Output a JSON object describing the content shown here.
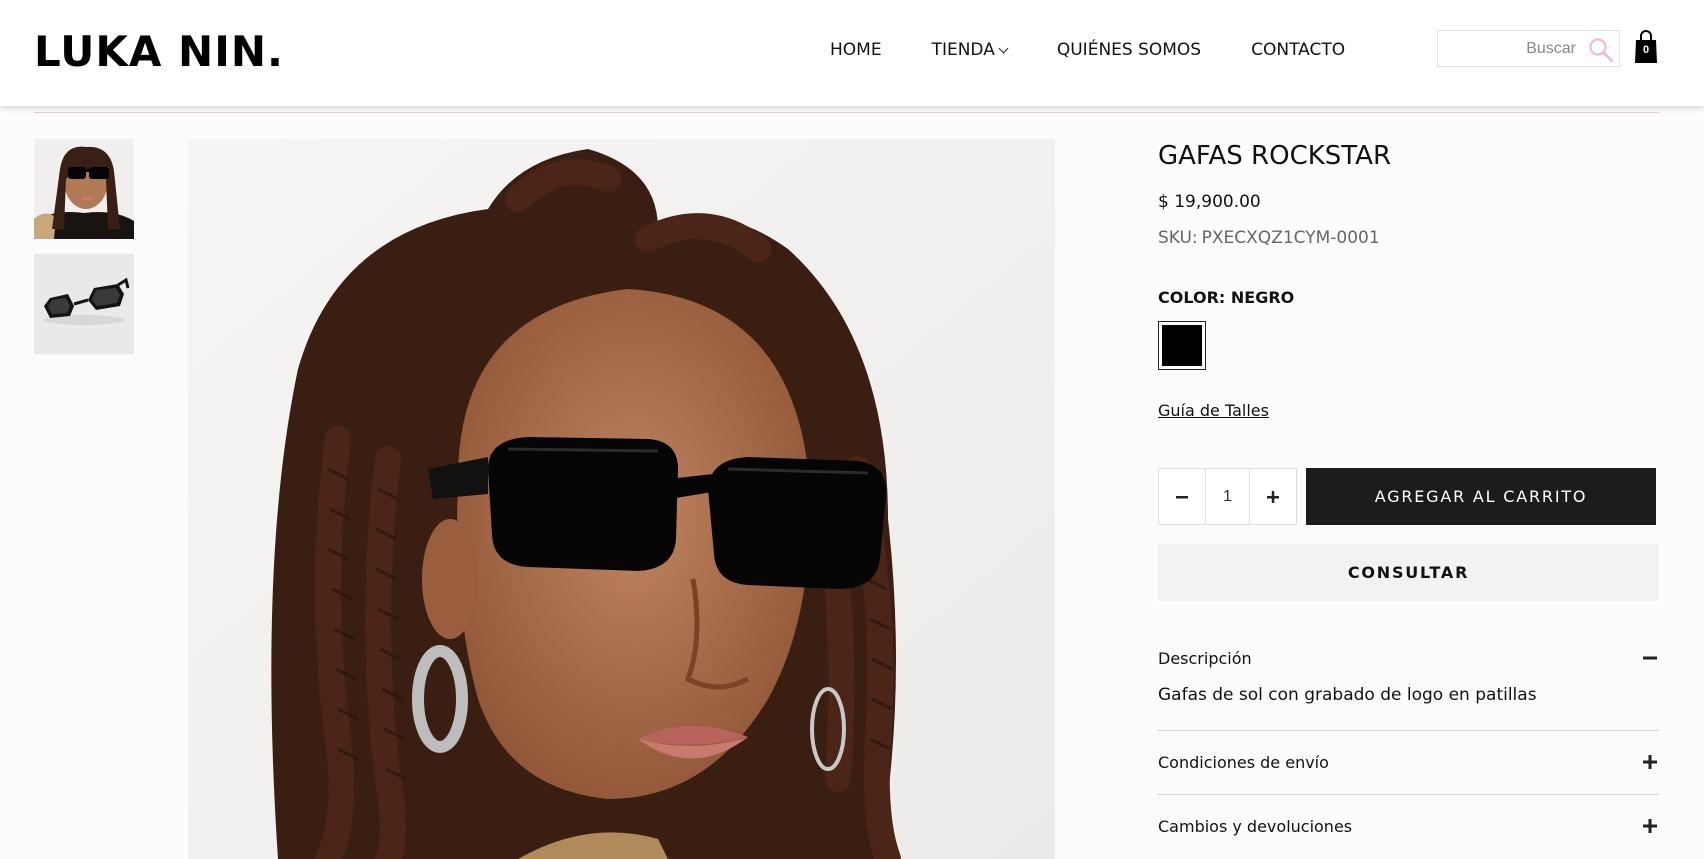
{
  "header": {
    "logo": "LUKA NIN.",
    "nav": [
      {
        "label": "HOME"
      },
      {
        "label": "TIENDA"
      },
      {
        "label": "QUIÉNES SOMOS"
      },
      {
        "label": "CONTACTO"
      }
    ],
    "search_placeholder": "Buscar",
    "cart_count": "0"
  },
  "product": {
    "title": "GAFAS ROCKSTAR",
    "price": "$ 19,900.00",
    "sku_label": "SKU:",
    "sku": "PXECXQZ1CYM-0001",
    "color_label": "COLOR:",
    "color_value": "NEGRO",
    "swatch_color": "#000000",
    "size_guide": "Guía de Talles",
    "quantity": "1",
    "add_to_cart": "AGREGAR AL CARRITO",
    "consult": "CONSULTAR"
  },
  "accordion": [
    {
      "title": "Descripción",
      "body": "Gafas de sol con grabado de logo en patillas",
      "open": true
    },
    {
      "title": "Condiciones de envío",
      "open": false
    },
    {
      "title": "Cambios y devoluciones",
      "open": false
    }
  ],
  "colors": {
    "accent_pink": "#ecc9d6",
    "button_dark": "#1c1c1c"
  }
}
